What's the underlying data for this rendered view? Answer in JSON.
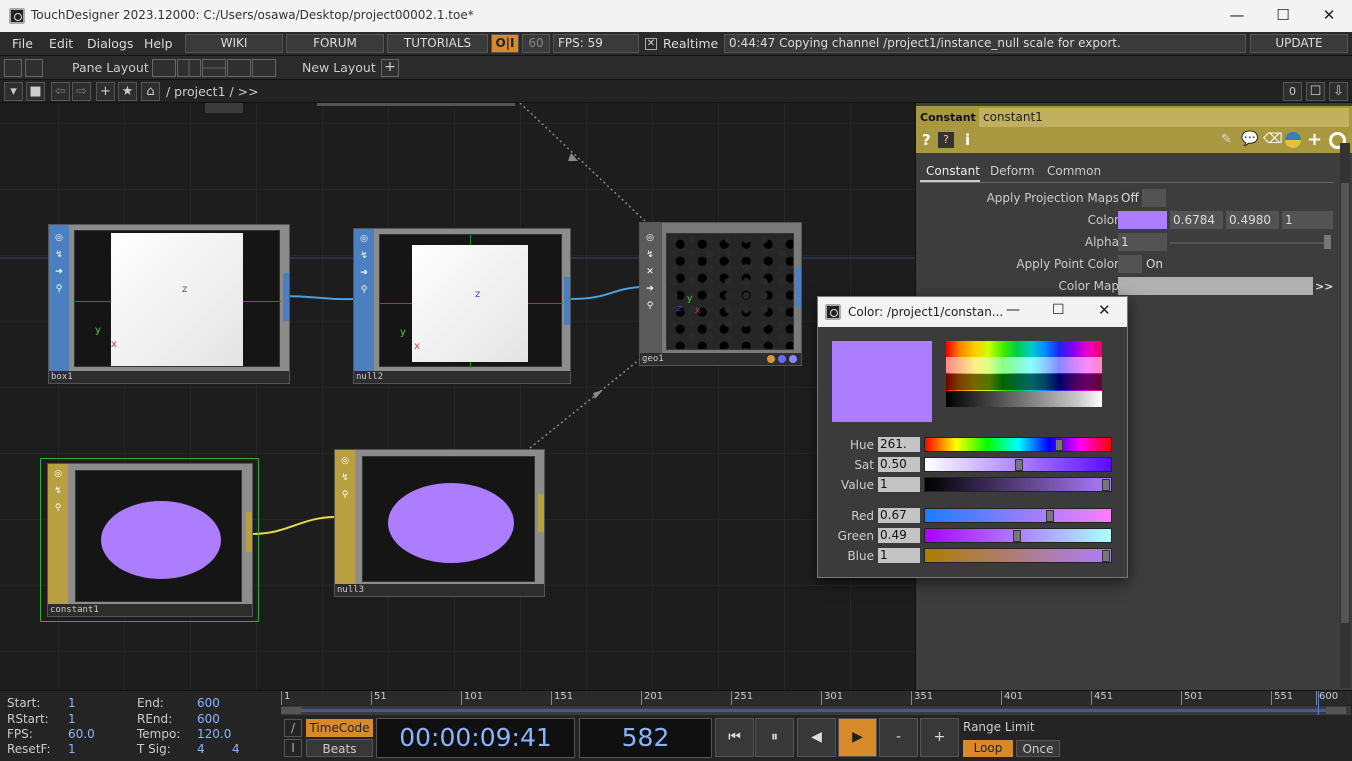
{
  "window": {
    "title": "TouchDesigner 2023.12000: C:/Users/osawa/Desktop/project00002.1.toe*",
    "minimize": "—",
    "maximize": "☐",
    "close": "✕"
  },
  "menu": {
    "file": "File",
    "edit": "Edit",
    "dialogs": "Dialogs",
    "help": "Help",
    "wiki": "WIKI",
    "forum": "FORUM",
    "tutorials": "TUTORIALS",
    "oi": "O|I",
    "fps_cap": "60",
    "fps_label": "FPS:",
    "fps_value": "59",
    "realtime_check": "✕",
    "realtime": "Realtime",
    "status": "0:44:47 Copying channel /project1/instance_null scale for export.",
    "update": "UPDATE"
  },
  "toolbar": {
    "pane_layout": "Pane Layout",
    "new_layout": "New Layout",
    "plus": "+"
  },
  "pathbar": {
    "path": "/ project1 / >>",
    "zero": "0"
  },
  "nodes": {
    "box1": "box1",
    "null2": "null2",
    "geo1": "geo1",
    "constant1": "constant1",
    "null3": "null3",
    "axis_z": "z",
    "axis_y": "y",
    "axis_x": "x"
  },
  "params": {
    "type": "Constant",
    "name": "constant1",
    "tabs": [
      "Constant",
      "Deform",
      "Common"
    ],
    "apply_projection_maps": "Apply Projection Maps",
    "apm_value": "Off",
    "color_label": "Color",
    "color_r": "0.6784",
    "color_g": "0.4980",
    "color_b": "1",
    "alpha_label": "Alpha",
    "alpha_value": "1",
    "apply_point_color": "Apply Point Color",
    "apc_value": "On",
    "color_map": "Color Map",
    "color_map_expand": ">>"
  },
  "color_dialog": {
    "title": "Color:  /project1/constan...",
    "hue_label": "Hue",
    "hue": "261.",
    "sat_label": "Sat",
    "sat": "0.50",
    "value_label": "Value",
    "value": "1",
    "red_label": "Red",
    "red": "0.67",
    "green_label": "Green",
    "green": "0.49",
    "blue_label": "Blue",
    "blue": "1",
    "swatch_color": "#ad7dff"
  },
  "bottom": {
    "start_k": "Start:",
    "start_v": "1",
    "end_k": "End:",
    "end_v": "600",
    "rstart_k": "RStart:",
    "rstart_v": "1",
    "rend_k": "REnd:",
    "rend_v": "600",
    "fps_k": "FPS:",
    "fps_v": "60.0",
    "tempo_k": "Tempo:",
    "tempo_v": "120.0",
    "resetf_k": "ResetF:",
    "resetf_v": "1",
    "tsig_k": "T Sig:",
    "tsig_a": "4",
    "tsig_b": "4",
    "timecode": "TimeCode",
    "beats": "Beats",
    "time": "00:00:09:41",
    "frame": "582",
    "range_limit": "Range Limit",
    "loop": "Loop",
    "once": "Once",
    "timeline_ticks": [
      "1",
      "51",
      "101",
      "151",
      "201",
      "251",
      "301",
      "351",
      "401",
      "451",
      "501",
      "551",
      "600"
    ],
    "slash": "/",
    "bar": "I",
    "first": "⏮",
    "pause": "⏸",
    "back": "◀",
    "play": "▶",
    "minus": "-",
    "plus": "+"
  }
}
